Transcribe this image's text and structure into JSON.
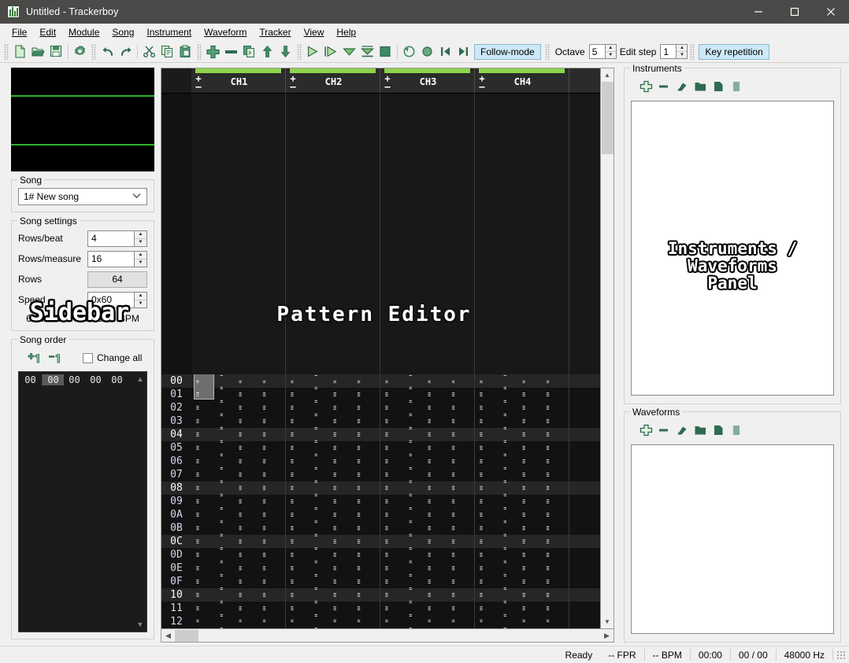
{
  "window": {
    "title": "Untitled - Trackerboy",
    "app_icon": "trackerboy-logo-icon",
    "minimize": "minimize-icon",
    "maximize": "maximize-icon",
    "close": "close-icon"
  },
  "menubar": {
    "items": [
      {
        "label": "File"
      },
      {
        "label": "Edit"
      },
      {
        "label": "Module"
      },
      {
        "label": "Song"
      },
      {
        "label": "Instrument"
      },
      {
        "label": "Waveform"
      },
      {
        "label": "Tracker"
      },
      {
        "label": "View"
      },
      {
        "label": "Help"
      }
    ]
  },
  "toolbar": {
    "icons": [
      "new-file-icon",
      "open-folder-icon",
      "save-icon",
      "module-settings-icon",
      "undo-icon",
      "redo-icon",
      "cut-icon",
      "copy-icon",
      "paste-icon",
      "add-icon",
      "remove-icon",
      "duplicate-icon",
      "move-up-icon",
      "move-down-icon",
      "play-icon",
      "play-pattern-icon",
      "play-from-cursor-icon",
      "play-to-end-icon",
      "stop-icon",
      "loop-pattern-icon",
      "record-icon",
      "prev-pattern-icon",
      "next-pattern-icon"
    ],
    "follow_mode_label": "Follow-mode",
    "octave_label": "Octave",
    "octave_value": "5",
    "edit_step_label": "Edit step",
    "edit_step_value": "1",
    "key_repetition_label": "Key repetition"
  },
  "sidebar": {
    "overlay_label": "Sidebar",
    "scope": {
      "name": "audio-scope",
      "color": "#2bb32b"
    },
    "song_group": {
      "title": "Song",
      "selected": "1# New song"
    },
    "song_settings": {
      "title": "Song settings",
      "rows": [
        {
          "label": "Rows/beat",
          "value": "4",
          "type": "spin"
        },
        {
          "label": "Rows/measure",
          "value": "16",
          "type": "spin"
        },
        {
          "label": "Rows",
          "value": "64",
          "type": "readonly"
        },
        {
          "label": "Speed",
          "value": "0x60",
          "type": "spin"
        }
      ],
      "fpr": "6.000 FPR",
      "bpm": "149.25 BPM"
    },
    "song_order": {
      "title": "Song order",
      "increment_icon": "increment-selection-icon",
      "decrement_icon": "decrement-selection-icon",
      "change_all_label": "Change all",
      "change_all_checked": false,
      "columns": [
        "00",
        "00",
        "00",
        "00"
      ],
      "rows": [
        {
          "index": "00",
          "cells": [
            "00",
            "00",
            "00",
            "00"
          ],
          "selected_cell": 0
        }
      ]
    }
  },
  "pattern_editor": {
    "overlay_label": "Pattern Editor",
    "channels": [
      {
        "name": "CH1",
        "add": "+",
        "remove": "–",
        "bar_color": "#8fd34a"
      },
      {
        "name": "CH2",
        "add": "+",
        "remove": "–",
        "bar_color": "#8fd34a"
      },
      {
        "name": "CH3",
        "add": "+",
        "remove": "–",
        "bar_color": "#8fd34a"
      },
      {
        "name": "CH4",
        "add": "+",
        "remove": "–",
        "bar_color": "#8fd34a"
      }
    ],
    "empty_note": "- - -",
    "empty_inst": "- -",
    "empty_fx": "- - -",
    "cursor_row": "00",
    "rows": [
      {
        "index": "00",
        "beat": true
      },
      {
        "index": "01",
        "beat": false
      },
      {
        "index": "02",
        "beat": false
      },
      {
        "index": "03",
        "beat": false
      },
      {
        "index": "04",
        "beat": true
      },
      {
        "index": "05",
        "beat": false
      },
      {
        "index": "06",
        "beat": false
      },
      {
        "index": "07",
        "beat": false
      },
      {
        "index": "08",
        "beat": true
      },
      {
        "index": "09",
        "beat": false
      },
      {
        "index": "0A",
        "beat": false
      },
      {
        "index": "0B",
        "beat": false
      },
      {
        "index": "0C",
        "beat": true
      },
      {
        "index": "0D",
        "beat": false
      },
      {
        "index": "0E",
        "beat": false
      },
      {
        "index": "0F",
        "beat": false
      },
      {
        "index": "10",
        "beat": true
      },
      {
        "index": "11",
        "beat": false
      },
      {
        "index": "12",
        "beat": false
      }
    ]
  },
  "right_panel": {
    "overlay_label_line1": "Instruments /",
    "overlay_label_line2": "Waveforms",
    "overlay_label_line3": "Panel",
    "instruments": {
      "title": "Instruments",
      "tools": [
        "add-instrument-icon",
        "remove-instrument-icon",
        "rename-instrument-icon",
        "open-instrument-icon",
        "duplicate-instrument-icon",
        "edit-instrument-icon"
      ]
    },
    "waveforms": {
      "title": "Waveforms",
      "tools": [
        "add-waveform-icon",
        "remove-waveform-icon",
        "rename-waveform-icon",
        "open-waveform-icon",
        "duplicate-waveform-icon",
        "edit-waveform-icon"
      ]
    }
  },
  "statusbar": {
    "status": "Ready",
    "fpr": "-- FPR",
    "bpm": "-- BPM",
    "time": "00:00",
    "position": "00 / 00",
    "samplerate": "48000 Hz"
  }
}
